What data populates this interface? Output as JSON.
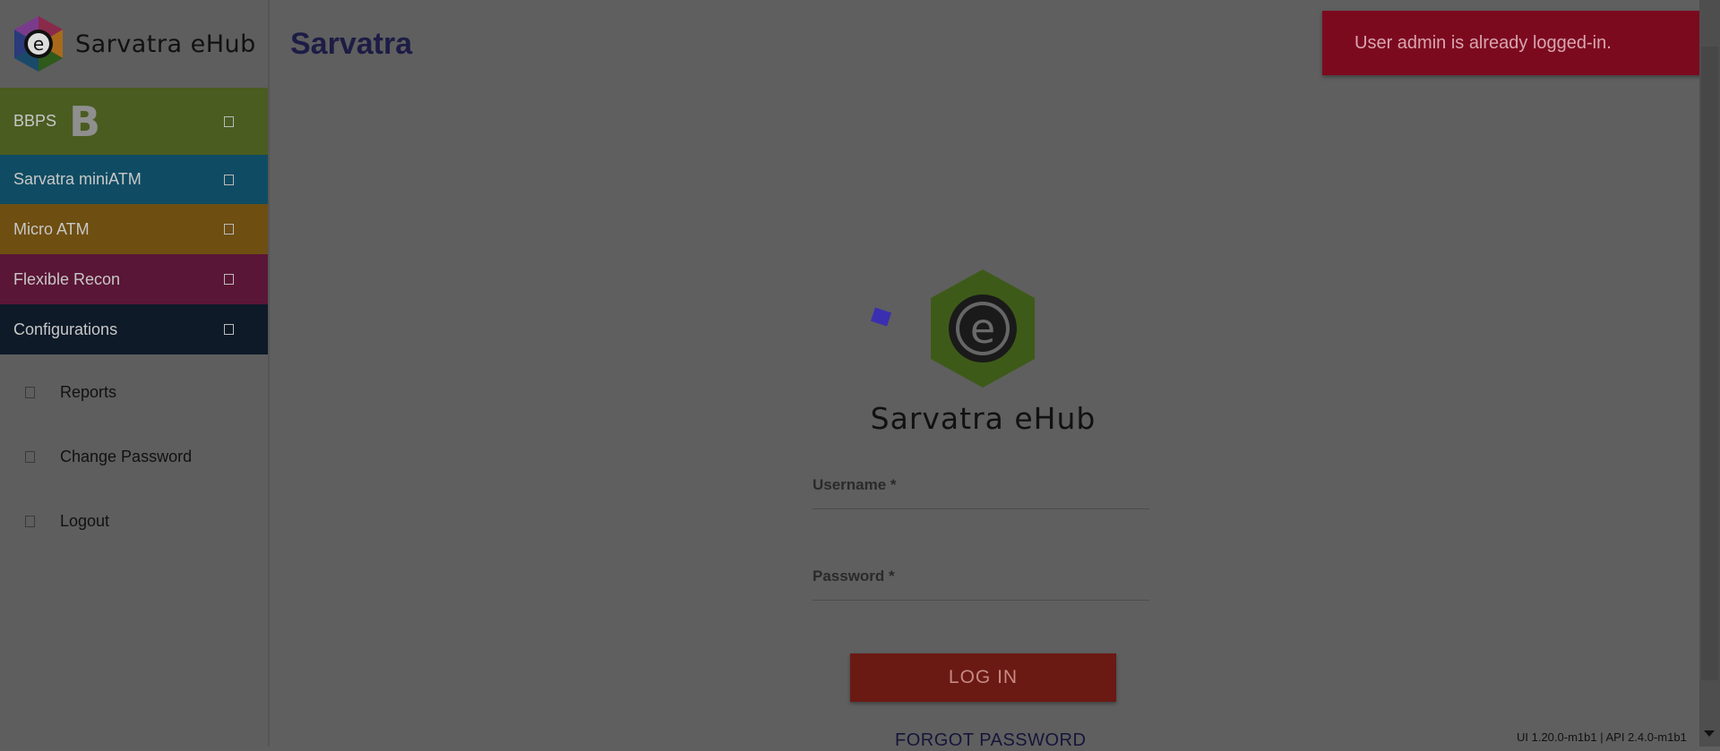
{
  "brand": {
    "name": "Sarvatra eHub"
  },
  "sidebar": {
    "menu": [
      {
        "label": "BBPS",
        "color": "#4a5c20"
      },
      {
        "label": "Sarvatra miniATM",
        "color": "#0f4c63"
      },
      {
        "label": "Micro ATM",
        "color": "#6e4e11"
      },
      {
        "label": "Flexible Recon",
        "color": "#5a1636"
      },
      {
        "label": "Configurations",
        "color": "#0e1a28"
      }
    ],
    "bbps_mark": "B",
    "links": [
      {
        "label": "Reports"
      },
      {
        "label": "Change Password"
      },
      {
        "label": "Logout"
      }
    ]
  },
  "header": {
    "title": "Sarvatra"
  },
  "toast": {
    "message": "User admin is already logged-in.",
    "color": "#7c0a1f"
  },
  "login": {
    "app_name": "Sarvatra eHub",
    "username_label": "Username *",
    "password_label": "Password *",
    "login_button": "LOG IN",
    "forgot_password": "FORGOT PASSWORD"
  },
  "footer": {
    "version": "UI 1.20.0-m1b1 | API 2.4.0-m1b1"
  }
}
